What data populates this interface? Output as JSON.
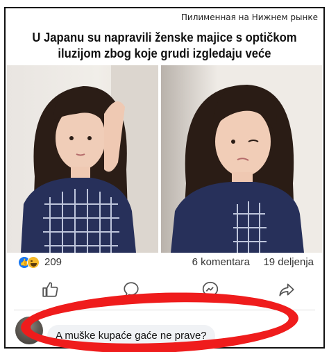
{
  "watermark": "Пилименная на Нижнем рынке",
  "headline": "U Japanu su napravili ženske majice s optičkom iluzijom zbog koje grudi izgledaju veće",
  "stats": {
    "reaction_count": "209",
    "comments": "6 komentara",
    "shares": "19 deljenja"
  },
  "actions": {
    "like_icon": "thumbs-up-icon",
    "comment_icon": "comment-bubble-icon",
    "messenger_icon": "messenger-icon",
    "share_icon": "share-arrow-icon"
  },
  "comment": {
    "author": "",
    "text": "A muške kupaće gaće ne prave?"
  },
  "colors": {
    "like_blue": "#1877f2",
    "haha_yellow": "#f7b928",
    "highlight_red": "#ef1c1c",
    "shirt_navy": "#27305a"
  }
}
